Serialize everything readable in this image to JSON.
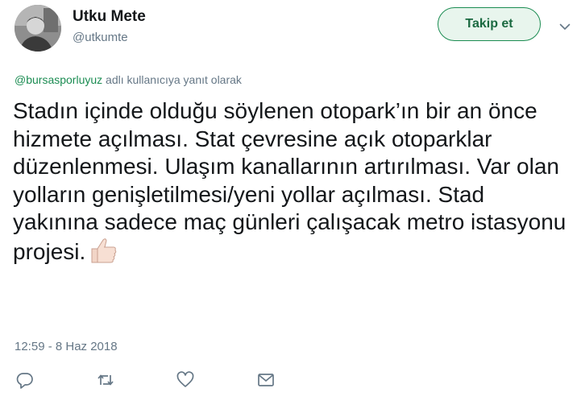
{
  "user": {
    "name": "Utku Mete",
    "handle": "@utkumte",
    "avatar": "profile-photo"
  },
  "follow_button": {
    "label": "Takip et"
  },
  "menu": {
    "icon": "chevron-down-icon"
  },
  "reply_context": {
    "mention": "@bursasporluyuz",
    "suffix": "adlı kullanıcıya yanıt olarak"
  },
  "tweet": {
    "text": "Stadın içinde olduğu söylenen otopark’ın bir an önce hizmete açılması. Stat çevresine açık otoparklar düzenlenmesi. Ulaşım kanallarının artırılması. Var olan yolların genişletilmesi/yeni yollar açılması. Stad yakınına sadece maç günleri çalışacak metro istasyonu projesi.",
    "emoji": "thumbs-up-light-skin-tone",
    "timestamp": "12:59 - 8 Haz 2018"
  },
  "actions": [
    {
      "name": "reply",
      "icon": "reply-icon"
    },
    {
      "name": "retweet",
      "icon": "retweet-icon"
    },
    {
      "name": "like",
      "icon": "heart-icon"
    },
    {
      "name": "message",
      "icon": "envelope-icon"
    }
  ],
  "colors": {
    "accent": "#1b8c52",
    "follow_bg": "#e8f5ed",
    "muted": "#657786",
    "text": "#14171a"
  }
}
